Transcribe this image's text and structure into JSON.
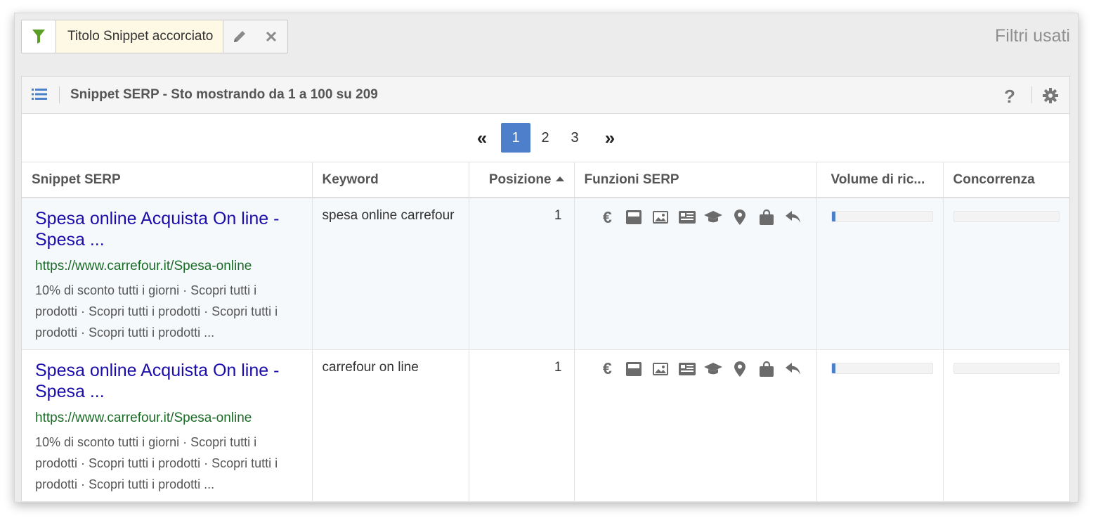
{
  "filter_chip": {
    "label": "Titolo Snippet accorciato"
  },
  "filters_used_label": "Filtri usati",
  "panel": {
    "title": "Snippet SERP - Sto mostrando da 1 a 100 su 209",
    "help": "?"
  },
  "pagination": {
    "first": "«",
    "pages": [
      "1",
      "2",
      "3"
    ],
    "current": "1",
    "last": "»"
  },
  "columns": [
    "Snippet SERP",
    "Keyword",
    "Posizione",
    "Funzioni SERP",
    "Volume di ric...",
    "Concorrenza"
  ],
  "serp_feature_icons": [
    "euro-icon",
    "featured-snippet-icon",
    "image-icon",
    "news-icon",
    "knowledge-icon",
    "map-pin-icon",
    "shopping-bag-icon",
    "reply-icon"
  ],
  "accent_color": "#4d7fcb",
  "rows": [
    {
      "snippet_title": "Spesa online Acquista On line - Spesa ...",
      "snippet_url": "https://www.carrefour.it/Spesa-online",
      "snippet_desc": "10% di sconto tutti i giorni · Scopri tutti i prodotti · Scopri tutti i prodotti · Scopri tutti i prodotti · Scopri tutti i prodotti ...",
      "keyword": "spesa online carrefour",
      "position": "1",
      "volume_fraction": 0.04,
      "competition_fraction": 0
    },
    {
      "snippet_title": "Spesa online Acquista On line - Spesa ...",
      "snippet_url": "https://www.carrefour.it/Spesa-online",
      "snippet_desc": "10% di sconto tutti i giorni · Scopri tutti i prodotti · Scopri tutti i prodotti · Scopri tutti i prodotti · Scopri tutti i prodotti ...",
      "keyword": "carrefour on line",
      "position": "1",
      "volume_fraction": 0.04,
      "competition_fraction": 0
    }
  ]
}
